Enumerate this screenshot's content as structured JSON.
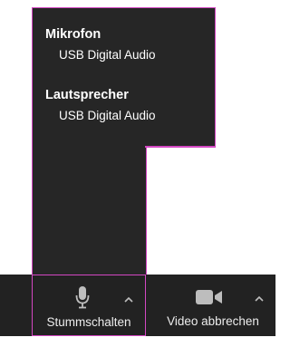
{
  "menu": {
    "microphone": {
      "header": "Mikrofon",
      "devices": [
        "USB Digital Audio"
      ]
    },
    "speaker": {
      "header": "Lautsprecher",
      "devices": [
        "USB Digital Audio"
      ]
    }
  },
  "toolbar": {
    "mute": {
      "label": "Stummschalten",
      "icon": "microphone-icon"
    },
    "video": {
      "label": "Video abbrechen",
      "icon": "video-camera-icon"
    }
  },
  "colors": {
    "panel_bg": "#262626",
    "toolbar_bg": "#222222",
    "highlight_border": "#d347c2",
    "icon_gray": "#bdbdbd"
  }
}
